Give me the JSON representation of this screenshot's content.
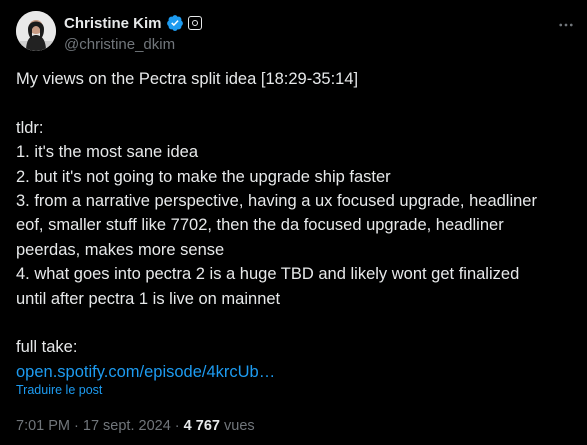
{
  "author": {
    "display_name": "Christine Kim",
    "handle": "@christine_dkim"
  },
  "tweet": {
    "lines": [
      "My views on the Pectra split idea [18:29-35:14]",
      "",
      "tldr:",
      "1. it's the most sane idea",
      "2. but it's not going to make the upgrade ship faster",
      "3. from a narrative perspective, having a ux focused upgrade, headliner",
      "eof, smaller stuff like 7702, then the da focused upgrade, headliner",
      "peerdas, makes more sense",
      "4. what goes into pectra 2 is a huge TBD and likely wont get finalized",
      "until after pectra 1 is live on mainnet",
      "",
      "full take:"
    ],
    "link_text": "open.spotify.com/episode/4krcUb…",
    "translate_label": "Traduire le post"
  },
  "meta": {
    "time": "7:01 PM",
    "separator": " · ",
    "date": "17 sept. 2024",
    "views_count": "4 767",
    "views_label": "vues"
  },
  "colors": {
    "background": "#000000",
    "text": "#e7e9ea",
    "muted": "#71767b",
    "link": "#1d9bf0",
    "verified": "#1d9bf0"
  },
  "icons": {
    "verified": "verified-badge-icon",
    "affiliate": "affiliate-badge-icon",
    "more": "more-options-icon"
  }
}
